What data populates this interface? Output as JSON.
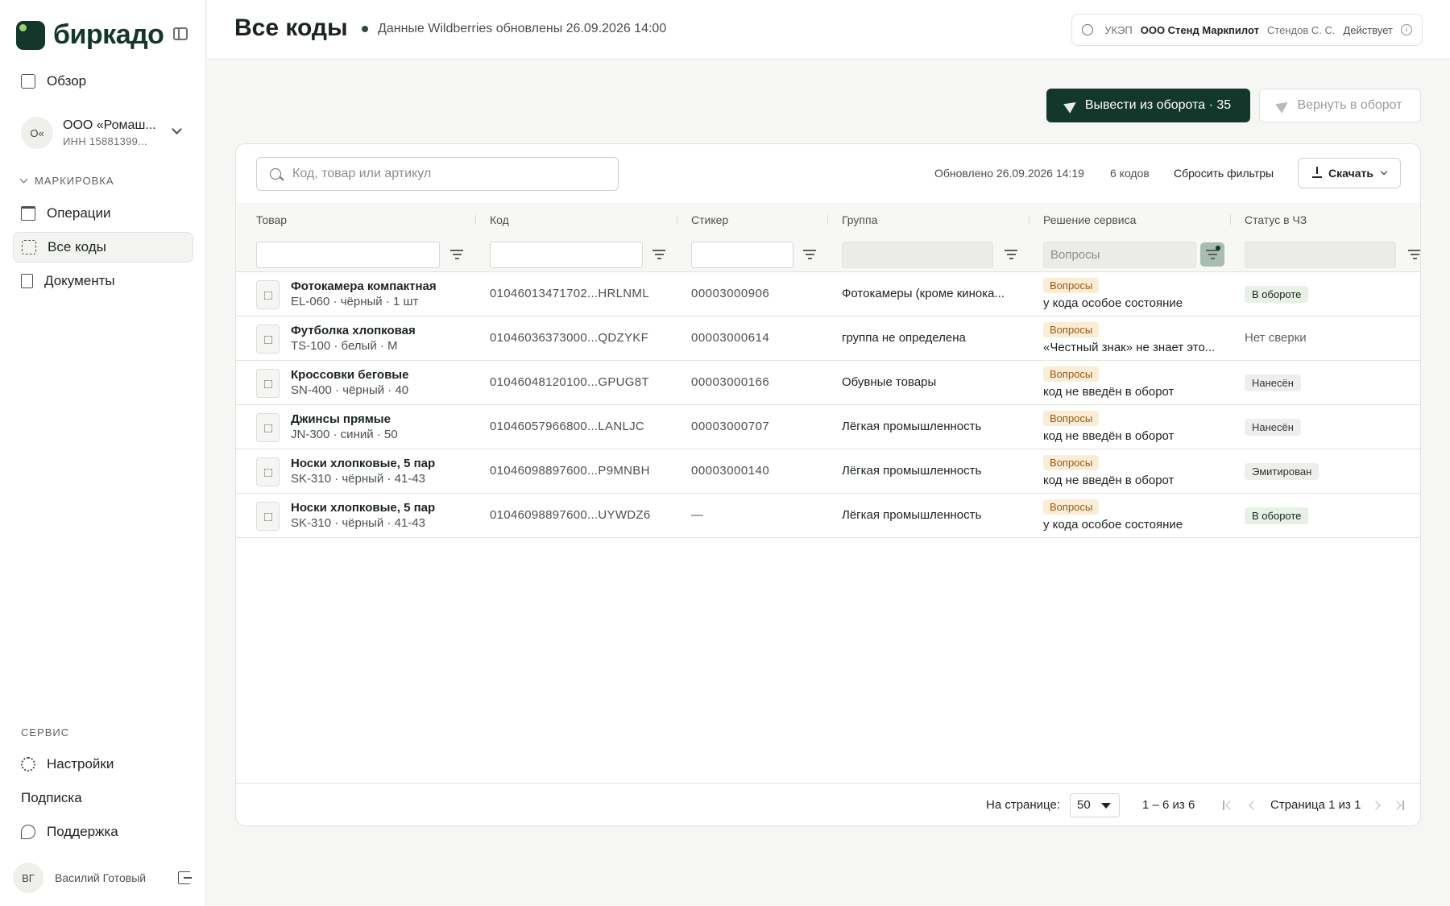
{
  "app": {
    "logo_text": "биркадо",
    "user": {
      "initials": "ВГ",
      "name": "Василий Готовый"
    }
  },
  "sidebar": {
    "overview": "Обзор",
    "org": {
      "avatar": "О«",
      "name": "ООО «Ромаш...",
      "inn": "ИНН 15881399..."
    },
    "section_marking": "МАРКИРОВКА",
    "marking_items": [
      "Операции",
      "Все коды",
      "Документы"
    ],
    "active_item": "Все коды",
    "section_service": "СЕРВИС",
    "service_items": [
      "Настройки",
      "Подписка",
      "Поддержка"
    ]
  },
  "header": {
    "title": "Все коды",
    "sync_status": "Данные Wildberries обновлены 26.09.2026 14:00",
    "ukep": {
      "label": "УКЭП",
      "org": "ООО Стенд Маркпилот",
      "person": "Стендов С. С.",
      "state": "Действует"
    }
  },
  "actions": {
    "withdraw_label": "Вывести из оборота · 35",
    "return_label": "Вернуть в оборот"
  },
  "toolbar": {
    "search_placeholder": "Код, товар или артикул",
    "updated": "Обновлено 26.09.2026 14:19",
    "count": "6 кодов",
    "reset_filters": "Сбросить фильтры",
    "download": "Скачать"
  },
  "table": {
    "columns": [
      "Товар",
      "Код",
      "Стикер",
      "Группа",
      "Решение сервиса",
      "Статус в ЧЗ"
    ],
    "filter_decision_value": "Вопросы",
    "rows": [
      {
        "name": "Фотокамера компактная",
        "sub": "EL-060 · чёрный · 1 шт",
        "code": "01046013471702...HRLNML",
        "sticker": "00003000906",
        "group": "Фотокамеры (кроме кинока...",
        "decision_badge": "Вопросы",
        "decision": "у кода особое состояние",
        "status": "В обороте",
        "status_style": "green"
      },
      {
        "name": "Футболка хлопковая",
        "sub": "TS-100 · белый · M",
        "code": "01046036373000...QDZYKF",
        "sticker": "00003000614",
        "group": "группа не определена",
        "decision_badge": "Вопросы",
        "decision": "«Честный знак» не знает это...",
        "status": "Нет сверки",
        "status_style": "plain"
      },
      {
        "name": "Кроссовки беговые",
        "sub": "SN-400 · чёрный · 40",
        "code": "01046048120100...GPUG8T",
        "sticker": "00003000166",
        "group": "Обувные товары",
        "decision_badge": "Вопросы",
        "decision": "код не введён в оборот",
        "status": "Нанесён",
        "status_style": "gray"
      },
      {
        "name": "Джинсы прямые",
        "sub": "JN-300 · синий · 50",
        "code": "01046057966800...LANLJC",
        "sticker": "00003000707",
        "group": "Лёгкая промышленность",
        "decision_badge": "Вопросы",
        "decision": "код не введён в оборот",
        "status": "Нанесён",
        "status_style": "gray"
      },
      {
        "name": "Носки хлопковые, 5 пар",
        "sub": "SK-310 · чёрный · 41-43",
        "code": "01046098897600...P9MNBH",
        "sticker": "00003000140",
        "group": "Лёгкая промышленность",
        "decision_badge": "Вопросы",
        "decision": "код не введён в оборот",
        "status": "Эмитирован",
        "status_style": "gray"
      },
      {
        "name": "Носки хлопковые, 5 пар",
        "sub": "SK-310 · чёрный · 41-43",
        "code": "01046098897600...UYWDZ6",
        "sticker": "—",
        "group": "Лёгкая промышленность",
        "decision_badge": "Вопросы",
        "decision": "у кода особое состояние",
        "status": "В обороте",
        "status_style": "green"
      }
    ]
  },
  "pagination": {
    "per_page_label": "На странице:",
    "per_page": "50",
    "range": "1 – 6 из 6",
    "page": "Страница 1 из 1"
  }
}
